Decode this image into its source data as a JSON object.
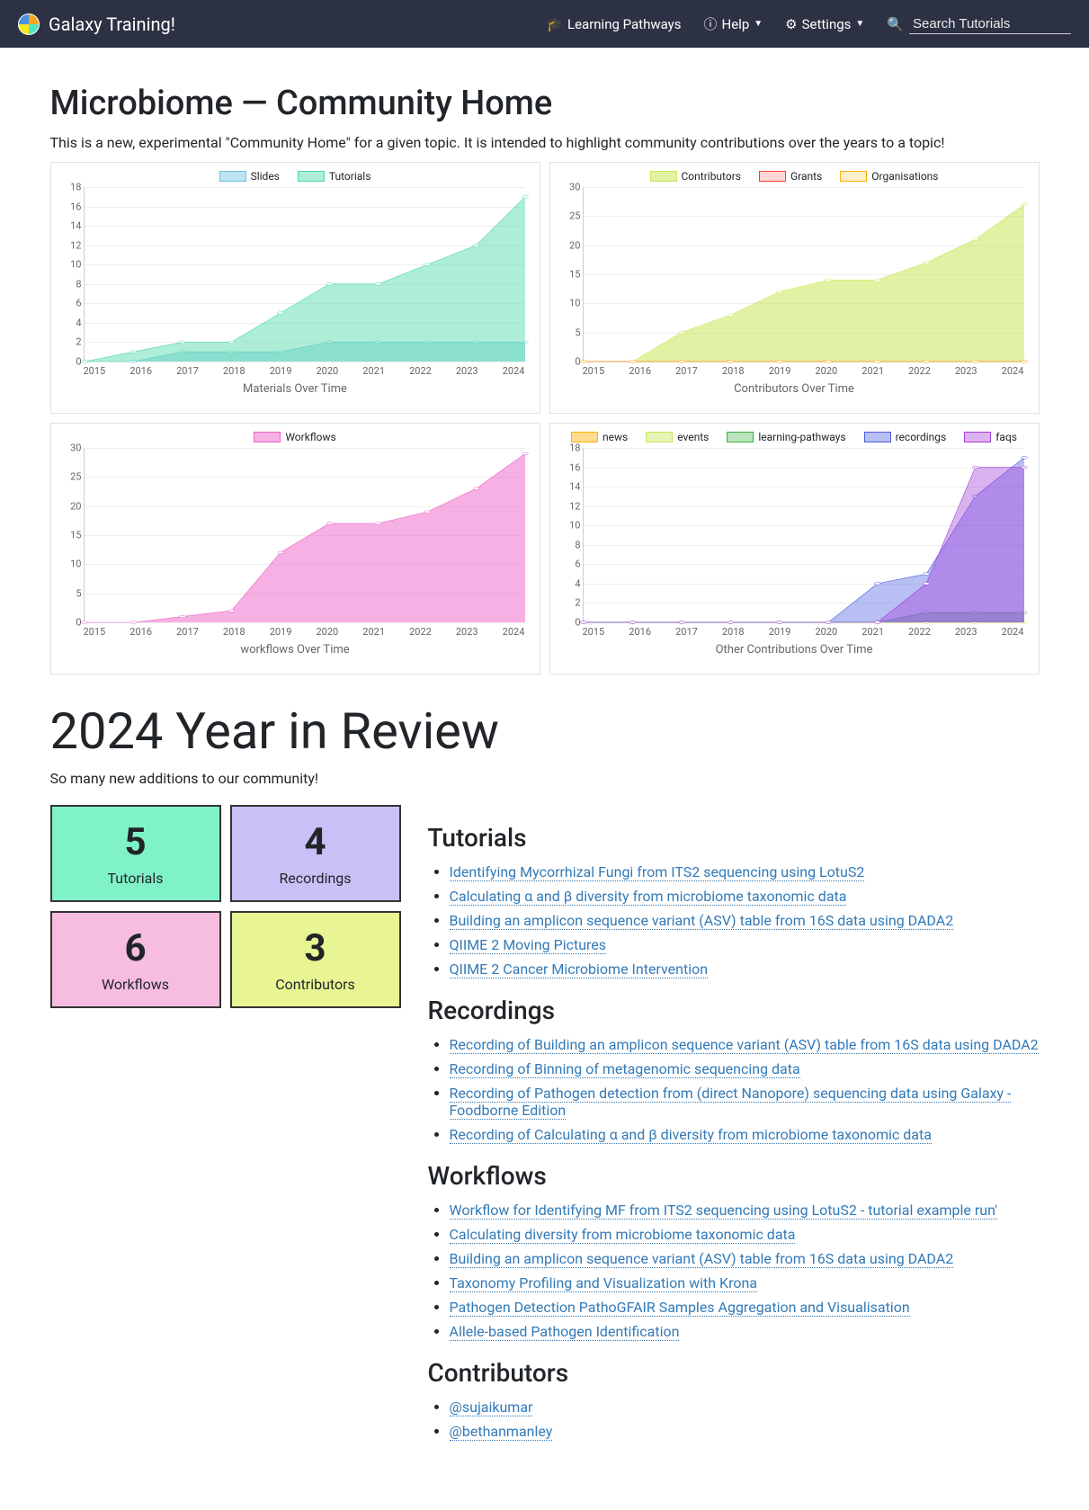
{
  "nav": {
    "brand": "Galaxy Training!",
    "learning_pathways": "Learning Pathways",
    "help": "Help",
    "settings": "Settings",
    "search_placeholder": "Search Tutorials"
  },
  "page": {
    "title": "Microbiome — Community Home",
    "intro": "This is a new, experimental \"Community Home\" for a given topic. It is intended to highlight community contributions over the years to a topic!",
    "year_title": "2024 Year in Review",
    "year_sub": "So many new additions to our community!"
  },
  "stats": [
    {
      "num": "5",
      "label": "Tutorials",
      "bg": "#7ff2c7"
    },
    {
      "num": "4",
      "label": "Recordings",
      "bg": "#c9c0f7"
    },
    {
      "num": "6",
      "label": "Workflows",
      "bg": "#f7bde0"
    },
    {
      "num": "3",
      "label": "Contributors",
      "bg": "#e8f592"
    }
  ],
  "sections": {
    "tutorials": {
      "title": "Tutorials",
      "items": [
        "Identifying Mycorrhizal Fungi from ITS2 sequencing using LotuS2",
        "Calculating α and β diversity from microbiome taxonomic data",
        "Building an amplicon sequence variant (ASV) table from 16S data using DADA2",
        "QIIME 2 Moving Pictures",
        "QIIME 2 Cancer Microbiome Intervention"
      ]
    },
    "recordings": {
      "title": "Recordings",
      "items": [
        "Recording of Building an amplicon sequence variant (ASV) table from 16S data using DADA2",
        "Recording of Binning of metagenomic sequencing data",
        "Recording of Pathogen detection from (direct Nanopore) sequencing data using Galaxy - Foodborne Edition",
        "Recording of Calculating α and β diversity from microbiome taxonomic data"
      ]
    },
    "workflows": {
      "title": "Workflows",
      "items": [
        "Workflow for Identifying MF from ITS2 sequencing using LotuS2 - tutorial example run'",
        "Calculating diversity from microbiome taxonomic data",
        "Building an amplicon sequence variant (ASV) table from 16S data using DADA2",
        "Taxonomy Profiling and Visualization with Krona",
        "Pathogen Detection PathoGFAIR Samples Aggregation and Visualisation",
        "Allele-based Pathogen Identification"
      ]
    },
    "contributors": {
      "title": "Contributors",
      "items": [
        "@sujaikumar",
        "@bethanmanley"
      ]
    }
  },
  "chart_data": [
    {
      "id": "materials",
      "title": "Materials Over Time",
      "type": "area",
      "x": [
        "2015",
        "2016",
        "2017",
        "2018",
        "2019",
        "2020",
        "2021",
        "2022",
        "2023",
        "2024"
      ],
      "ylim": [
        0,
        18
      ],
      "ystep": 2,
      "series": [
        {
          "name": "Slides",
          "color": "#6cc3e0",
          "fill": "rgba(108,195,224,0.45)",
          "values": [
            0,
            0,
            1,
            1,
            1,
            2,
            2,
            2,
            2,
            2
          ]
        },
        {
          "name": "Tutorials",
          "color": "#4cd9a3",
          "fill": "rgba(76,217,163,0.45)",
          "values": [
            0,
            1,
            2,
            2,
            5,
            8,
            8,
            10,
            12,
            17
          ]
        }
      ]
    },
    {
      "id": "contributors",
      "title": "Contributors Over Time",
      "type": "area",
      "x": [
        "2015",
        "2016",
        "2017",
        "2018",
        "2019",
        "2020",
        "2021",
        "2022",
        "2023",
        "2024"
      ],
      "ylim": [
        0,
        30
      ],
      "ystep": 5,
      "series": [
        {
          "name": "Contributors",
          "color": "#c8e85a",
          "fill": "rgba(200,232,90,0.55)",
          "values": [
            0,
            0,
            5,
            8,
            12,
            14,
            14,
            17,
            21,
            27
          ]
        },
        {
          "name": "Grants",
          "color": "#ff3b30",
          "fill": "rgba(255,59,48,0.2)",
          "values": [
            0,
            0,
            0,
            0,
            0,
            0,
            0,
            0,
            0,
            0
          ]
        },
        {
          "name": "Organisations",
          "color": "#ffb000",
          "fill": "rgba(255,176,0,0.2)",
          "values": [
            0,
            0,
            0,
            0,
            0,
            0,
            0,
            0,
            0,
            0
          ]
        }
      ]
    },
    {
      "id": "workflows",
      "title": "workflows Over Time",
      "type": "area",
      "x": [
        "2015",
        "2016",
        "2017",
        "2018",
        "2019",
        "2020",
        "2021",
        "2022",
        "2023",
        "2024"
      ],
      "ylim": [
        0,
        30
      ],
      "ystep": 5,
      "series": [
        {
          "name": "Workflows",
          "color": "#ed62c7",
          "fill": "rgba(237,98,199,0.5)",
          "values": [
            0,
            0,
            1,
            2,
            12,
            17,
            17,
            19,
            23,
            29
          ]
        }
      ]
    },
    {
      "id": "other",
      "title": "Other Contributions Over Time",
      "type": "area",
      "x": [
        "2015",
        "2016",
        "2017",
        "2018",
        "2019",
        "2020",
        "2021",
        "2022",
        "2023",
        "2024"
      ],
      "ylim": [
        0,
        18
      ],
      "ystep": 2,
      "series": [
        {
          "name": "news",
          "color": "#ffb000",
          "fill": "rgba(255,176,0,0.45)",
          "values": [
            0,
            0,
            0,
            0,
            0,
            0,
            0,
            0,
            0,
            0
          ]
        },
        {
          "name": "events",
          "color": "#c8e85a",
          "fill": "rgba(200,232,90,0.45)",
          "values": [
            0,
            0,
            0,
            0,
            0,
            0,
            0,
            0,
            0,
            0
          ]
        },
        {
          "name": "learning-pathways",
          "color": "#3cb043",
          "fill": "rgba(60,176,67,0.35)",
          "values": [
            0,
            0,
            0,
            0,
            0,
            0,
            0,
            1,
            1,
            1
          ]
        },
        {
          "name": "recordings",
          "color": "#4a5fe0",
          "fill": "rgba(74,95,224,0.4)",
          "values": [
            0,
            0,
            0,
            0,
            0,
            0,
            4,
            5,
            13,
            17
          ]
        },
        {
          "name": "faqs",
          "color": "#a63fd9",
          "fill": "rgba(166,63,217,0.4)",
          "values": [
            0,
            0,
            0,
            0,
            0,
            0,
            0,
            4,
            16,
            16
          ]
        }
      ]
    }
  ]
}
